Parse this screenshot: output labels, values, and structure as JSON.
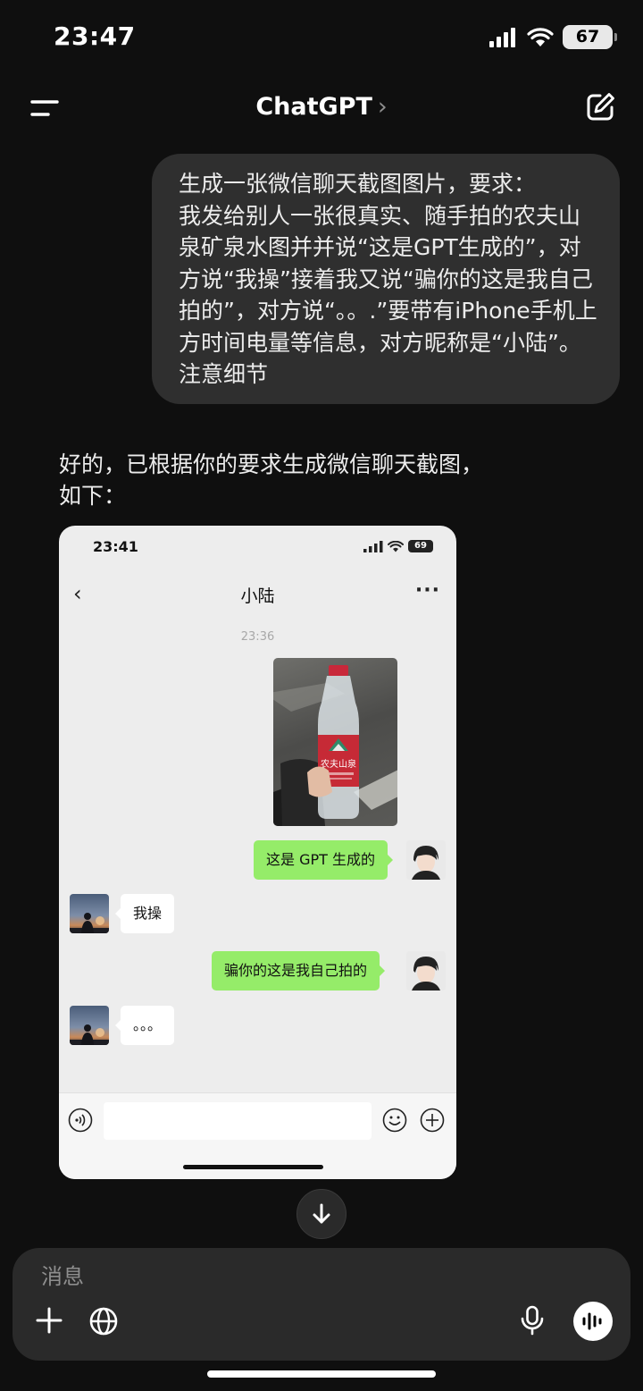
{
  "status_bar": {
    "time": "23:47",
    "battery": "67"
  },
  "nav": {
    "title": "ChatGPT",
    "chevron": "›"
  },
  "user_message": "生成一张微信聊天截图图片，要求：\n我发给别人一张很真实、随手拍的农夫山泉矿泉水图并并说“这是GPT生成的”，对方说“我操”接着我又说“骗你的这是我自己拍的”，对方说“。。.”要带有iPhone手机上方时间电量等信息，对方昵称是“小陆”。注意细节",
  "assistant_message": "好的，已根据你的要求生成微信聊天截图，\n如下：",
  "generated_image": {
    "status_time": "23:41",
    "battery": "69",
    "back": "‹",
    "contact_name": "小陆",
    "more": "···",
    "timestamp": "23:36",
    "bottle_label": "农夫山泉",
    "messages": [
      {
        "side": "me",
        "text": "这是 GPT 生成的"
      },
      {
        "side": "them",
        "text": "我操"
      },
      {
        "side": "me",
        "text": "骗你的这是我自己拍的"
      },
      {
        "side": "them",
        "text": "。。。"
      }
    ]
  },
  "composer": {
    "placeholder": "消息"
  },
  "colors": {
    "background": "#0f0f0f",
    "bubble": "#2f2f2f",
    "wechat_green": "#95ec69",
    "wechat_bg": "#ededed"
  },
  "icons": [
    "menu-icon",
    "new-chat-icon",
    "signal-icon",
    "wifi-icon",
    "battery-icon",
    "arrow-down-icon",
    "plus-icon",
    "globe-icon",
    "microphone-icon",
    "voice-mode-icon"
  ]
}
